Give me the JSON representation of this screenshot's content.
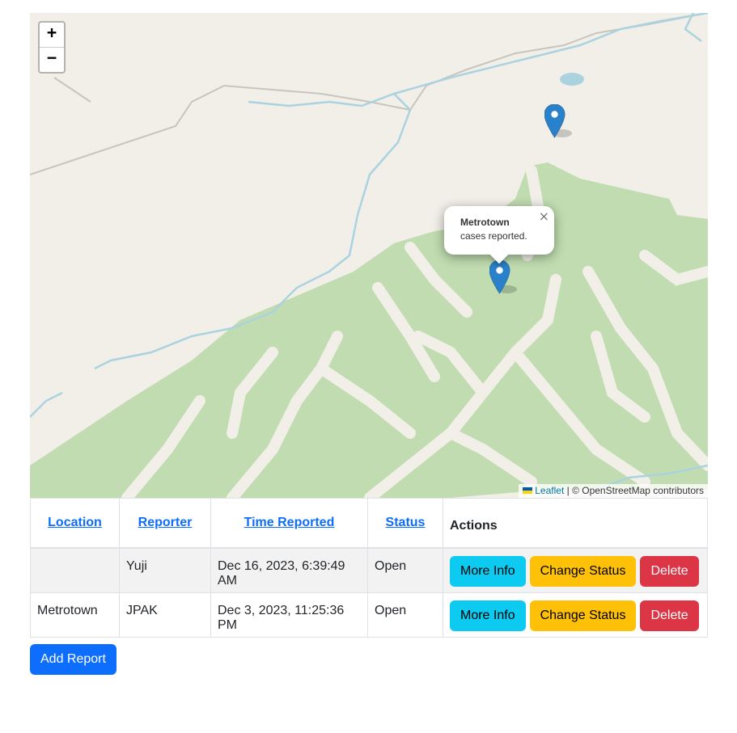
{
  "map": {
    "zoom_in_label": "+",
    "zoom_out_label": "−",
    "popup": {
      "title": "Metrotown",
      "text": "cases reported.",
      "close_label": "×"
    },
    "markers": [
      "marker-icon",
      "marker-icon"
    ],
    "attribution": {
      "leaflet_label": "Leaflet",
      "separator": " | ",
      "osm_text": "© OpenStreetMap contributors"
    },
    "colors": {
      "land": "#f2efe9",
      "forest": "#c0dcb0",
      "water": "#aad3df",
      "marker": "#2a81cb"
    }
  },
  "table": {
    "headers": {
      "location": "Location",
      "reporter": "Reporter",
      "time": "Time Reported",
      "status": "Status",
      "actions": "Actions"
    },
    "rows": [
      {
        "location": "",
        "reporter": "Yuji",
        "time": "Dec 16, 2023, 6:39:49 AM",
        "status": "Open"
      },
      {
        "location": "Metrotown",
        "reporter": "JPAK",
        "time": "Dec 3, 2023, 11:25:36 PM",
        "status": "Open"
      }
    ],
    "actions": {
      "more_info": "More Info",
      "change_status": "Change Status",
      "delete": "Delete"
    }
  },
  "add_report_label": "Add Report",
  "colors": {
    "primary": "#0d6efd",
    "info": "#0dcaf0",
    "warning": "#ffc107",
    "danger": "#dc3545"
  }
}
